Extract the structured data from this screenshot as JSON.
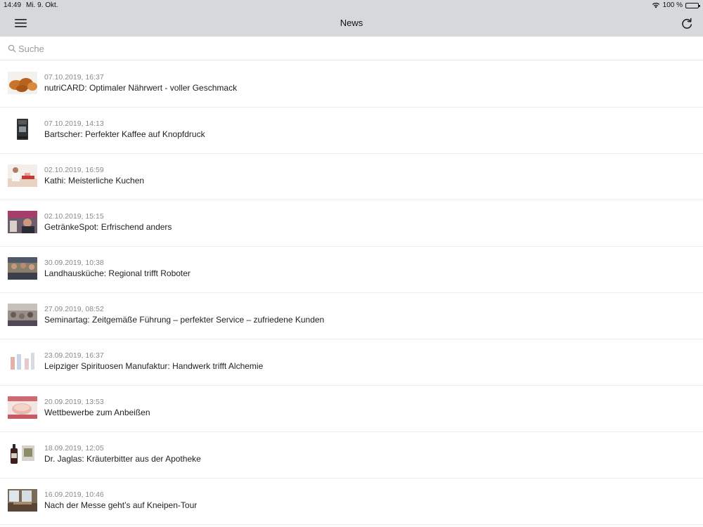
{
  "status": {
    "time": "14:49",
    "date": "Mi. 9. Okt.",
    "battery": "100 %"
  },
  "navbar": {
    "title": "News",
    "menu_icon": "hamburger-menu-icon",
    "refresh_icon": "refresh-icon"
  },
  "search": {
    "placeholder": "Suche",
    "value": ""
  },
  "news": [
    {
      "date": "07.10.2019, 16:37",
      "title": "nutriCARD: Optimaler Nährwert - voller Geschmack",
      "thumb": "potatoes"
    },
    {
      "date": "07.10.2019, 14:13",
      "title": "Bartscher: Perfekter Kaffee auf Knopfdruck",
      "thumb": "coffee-machine"
    },
    {
      "date": "02.10.2019, 16:59",
      "title": "Kathi: Meisterliche Kuchen",
      "thumb": "baker"
    },
    {
      "date": "02.10.2019, 15:15",
      "title": "GetränkeSpot: Erfrischend anders",
      "thumb": "drinks-stand"
    },
    {
      "date": "30.09.2019, 10:38",
      "title": "Landhausküche: Regional trifft Roboter",
      "thumb": "kitchen-people"
    },
    {
      "date": "27.09.2019, 08:52",
      "title": "Seminartag: Zeitgemäße Führung – perfekter Service – zufriedene Kunden",
      "thumb": "seminar"
    },
    {
      "date": "23.09.2019, 16:37",
      "title": "Leipziger Spirituosen Manufaktur: Handwerk trifft Alchemie",
      "thumb": "bottles-white"
    },
    {
      "date": "20.09.2019, 13:53",
      "title": "Wettbewerbe zum Anbeißen",
      "thumb": "cake-competition"
    },
    {
      "date": "18.09.2019, 12:05",
      "title": "Dr. Jaglas: Kräuterbitter aus der Apotheke",
      "thumb": "bitter-bottle"
    },
    {
      "date": "16.09.2019, 10:46",
      "title": "Nach der Messe geht’s auf Kneipen-Tour",
      "thumb": "pub-interior"
    }
  ]
}
